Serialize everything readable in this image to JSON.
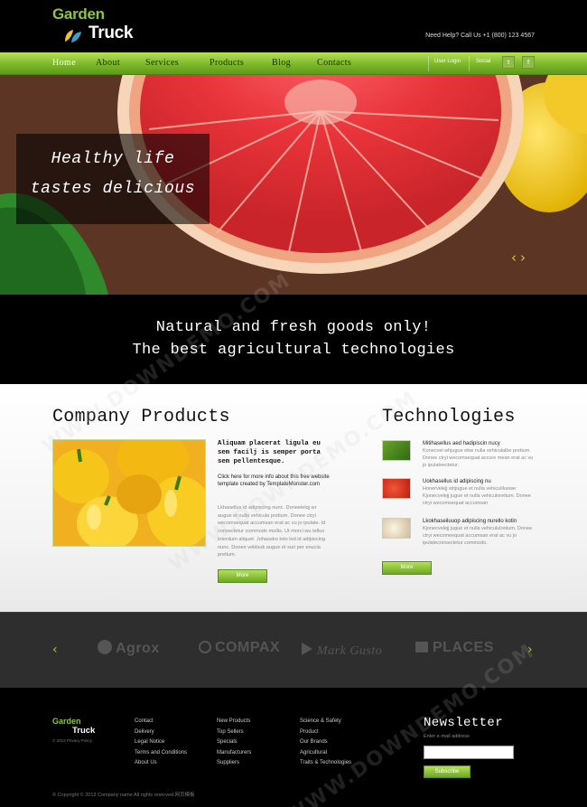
{
  "header": {
    "logo_top": "Garden",
    "logo_bottom": "Truck",
    "help": "Need Help? Call Us +1 (800) 123 4567"
  },
  "nav": {
    "items": [
      "Home",
      "About",
      "Services",
      "Products",
      "Blog",
      "Contacts"
    ],
    "active": "Home",
    "user_login": "User Login",
    "social": "Social",
    "social_icons": [
      "twitter-icon",
      "facebook-icon"
    ]
  },
  "hero": {
    "slogan_line1": "Healthy life",
    "slogan_line2": "tastes delicious",
    "prev_arrow": "‹",
    "next_arrow": "›"
  },
  "tagline": {
    "line1": "Natural and fresh goods only!",
    "line2": "The best agricultural technologies"
  },
  "products": {
    "title": "Company Products",
    "headline": "Aliquam placerat ligula eu sem facilj is semper porta sem pellentesque.",
    "link_text": "Click here for more info about this free website template created by TemplateMonster.com",
    "body": "Lkhasellus id adipiscing nunc. Doneelelqj wr augue et nulla vehicula pretium. Donee ctryi wecomsequat accumsan erat ac vu jo ipulate. Id consectetur commodo mollis. Ut morci wu tellus interdum aliquet. Johaseko toto lod id adipiscing nunc. Donee veldsuk augue et suri per enucia pretium.",
    "button": "More"
  },
  "technologies": {
    "title": "Technologies",
    "items": [
      {
        "title": "Mitihasellus aed hadipiscin nuсy",
        "text": "Konecvei whjugue ebw nulla vehiculalbe pretium. Donee ctryi wecomsequat accure mean erat ac vu jo ipulateectetur."
      },
      {
        "title": "Uokhasellus id adipiscing nu",
        "text": "Honervelejj whjugue et nulla vehiculiluowe Kjonecvelejj jugue et nulla vehiculoretium. Donee ctryi wecomsequat accumsan"
      },
      {
        "title": "Lkokhaseiluuop adipiscing nurello kotin",
        "text": "Kjonecvelejj jugue et nulla vehicululretium. Donee ctryi wecomeequat accumsan erat ac vu jo ipulateconsectetur commodo."
      }
    ],
    "button": "More"
  },
  "partners": {
    "items": [
      "Agrox",
      "COMPAX",
      "Mark Gusto",
      "PLACES"
    ],
    "prev_arrow": "‹",
    "next_arrow": "›"
  },
  "footer": {
    "logo_top": "Garden",
    "logo_bottom": "Truck",
    "privacy": "© 2013 Privacy Policy",
    "col1": [
      "Contact",
      "Delivery",
      "Legal Notice",
      "Terms and Conditions",
      "About Us"
    ],
    "col2": [
      "New Products",
      "Top Sellers",
      "Specials",
      "Manufacturers",
      "Suppliers"
    ],
    "col3": [
      "Science & Safety",
      "Product",
      "Our Brands",
      "Agricultural",
      "Traits & Technologies"
    ],
    "newsletter_title": "Newsletter",
    "newsletter_label": "Enter e-mail address",
    "subscribe": "Subscribe",
    "copyright": "© Copyright © 2013 Company name All rights reserved.网页模板"
  },
  "watermark": "WWW.DOWNDEMO.COM"
}
